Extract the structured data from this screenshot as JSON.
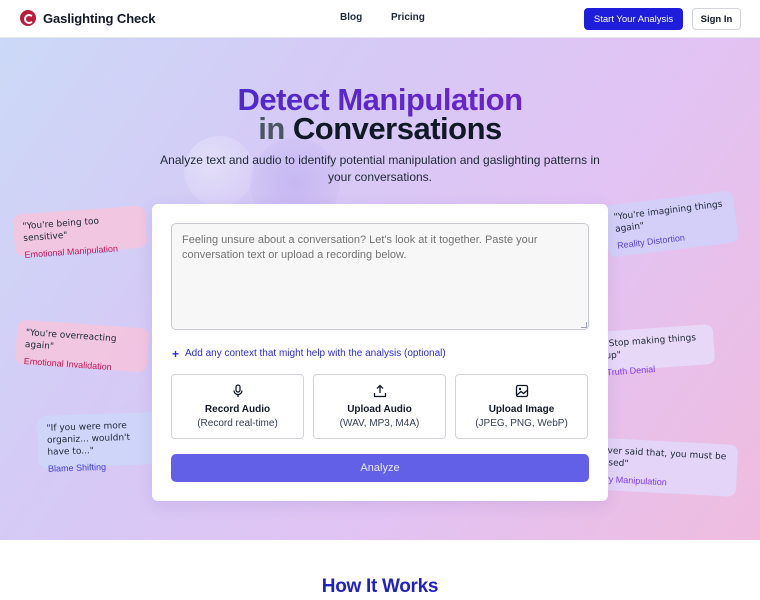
{
  "header": {
    "brand": "Gaslighting Check",
    "nav": [
      "Blog",
      "Pricing"
    ],
    "cta_label": "Start Your Analysis",
    "signin_label": "Sign In"
  },
  "hero": {
    "title_line1": "Detect Manipulation",
    "title_in": "in",
    "title_line2": "Conversations",
    "subtitle": "Analyze text and audio to identify potential manipulation and gaslighting patterns in your conversations."
  },
  "floating_cards": [
    {
      "quote": "\"You're being too sensitive\"",
      "label": "Emotional Manipulation"
    },
    {
      "quote": "\"You're overreacting again\"",
      "label": "Emotional Invalidation"
    },
    {
      "quote": "\"If you were more organiz... wouldn't have to...\"",
      "label": "Blame Shifting"
    },
    {
      "quote": "\"You're imagining things again\"",
      "label": "Reality Distortion"
    },
    {
      "quote": "\"Stop making things up\"",
      "label": "Truth Denial"
    },
    {
      "quote": "\"...ver said that, you must be ...used\"",
      "label": "...ory Manipulation"
    }
  ],
  "form": {
    "textarea_placeholder": "Feeling unsure about a conversation? Let's look at it together. Paste your conversation text or upload a recording below.",
    "context_link": "Add any context that might help with the analysis (optional)",
    "options": [
      {
        "title": "Record Audio",
        "sub": "(Record real-time)",
        "icon": "microphone-icon"
      },
      {
        "title": "Upload Audio",
        "sub": "(WAV, MP3, M4A)",
        "icon": "upload-icon"
      },
      {
        "title": "Upload Image",
        "sub": "(JPEG, PNG, WebP)",
        "icon": "image-icon"
      }
    ],
    "analyze_label": "Analyze"
  },
  "section_heading": "How It Works",
  "colors": {
    "primary": "#1d1ddb",
    "analyze_button": "#6160e6",
    "link": "#2a2ae0",
    "title_gradient_start": "#3b2bc9",
    "title_gradient_end": "#7e22ce"
  }
}
